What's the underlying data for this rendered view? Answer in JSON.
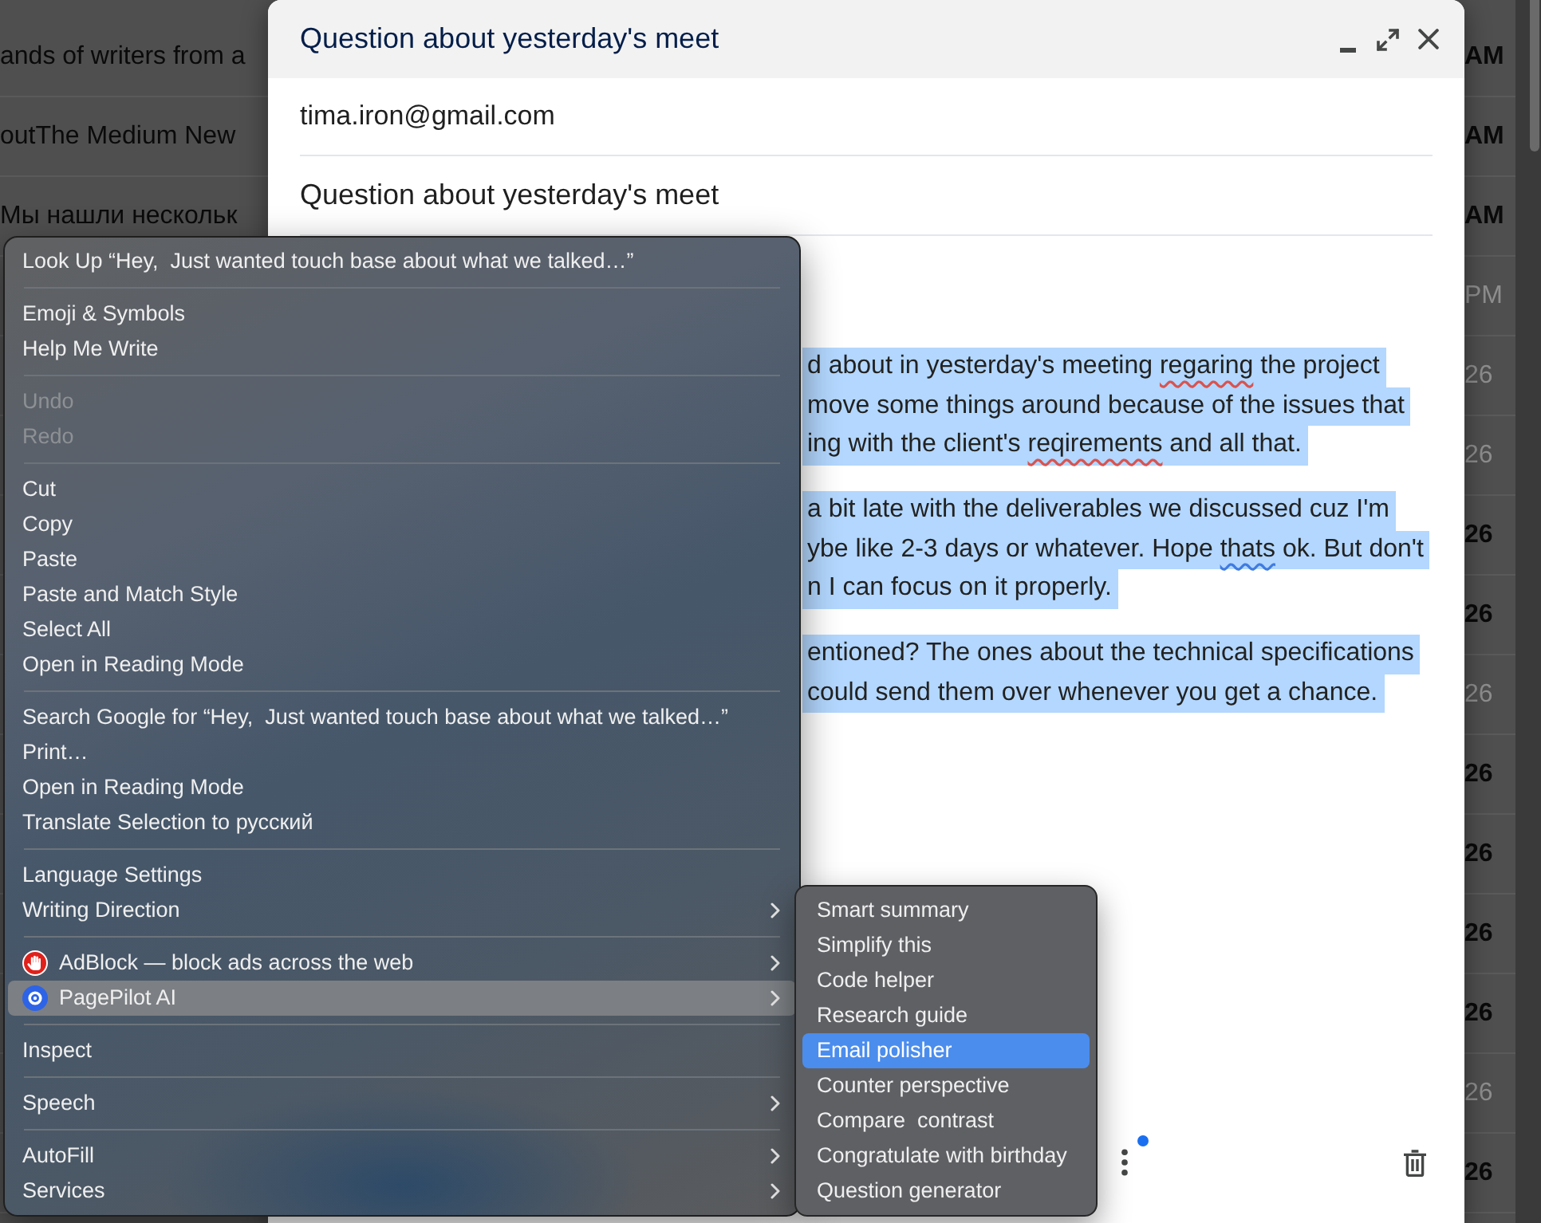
{
  "inbox": {
    "rows": [
      {
        "snippet": "ands of writers from a",
        "time": "AM",
        "unread": true
      },
      {
        "snippet": "outThe Medium New",
        "time": "AM",
        "unread": true
      },
      {
        "snippet": "Мы нашли нескольк",
        "time": "AM",
        "unread": true
      },
      {
        "time": "PM",
        "unread": false
      },
      {
        "time": "26",
        "unread": false
      },
      {
        "time": "26",
        "unread": false
      },
      {
        "time": "26",
        "unread": true
      },
      {
        "time": "26",
        "unread": true
      },
      {
        "time": "26",
        "unread": false
      },
      {
        "time": "26",
        "unread": true
      },
      {
        "time": "26",
        "unread": true
      },
      {
        "time": "26",
        "unread": true
      },
      {
        "time": "26",
        "unread": true
      },
      {
        "time": "26",
        "unread": false
      },
      {
        "time": "26",
        "unread": true
      }
    ]
  },
  "compose": {
    "title": "Question about yesterday's meet",
    "recipient": "tima.iron@gmail.com",
    "subject": "Question about yesterday's meet",
    "body": {
      "selected": true,
      "paragraphs": [
        {
          "lines": [
            {
              "parts": [
                {
                  "text": "d about in yesterday's meeting ",
                  "kind": "plain"
                },
                {
                  "text": "regaring",
                  "kind": "spelling"
                },
                {
                  "text": " the project",
                  "kind": "plain"
                }
              ]
            },
            {
              "parts": [
                {
                  "text": "move some things around because of the issues that",
                  "kind": "plain"
                }
              ]
            },
            {
              "parts": [
                {
                  "text": "ing with the client's ",
                  "kind": "plain"
                },
                {
                  "text": "reqirements",
                  "kind": "spelling"
                },
                {
                  "text": " and all that.",
                  "kind": "plain"
                }
              ]
            }
          ]
        },
        {
          "lines": [
            {
              "parts": [
                {
                  "text": "a bit late with the deliverables we discussed cuz I'm",
                  "kind": "plain"
                }
              ]
            },
            {
              "parts": [
                {
                  "text": "ybe like 2-3 days or whatever. Hope ",
                  "kind": "plain"
                },
                {
                  "text": "thats",
                  "kind": "grammar"
                },
                {
                  "text": " ok. But don't",
                  "kind": "plain"
                }
              ]
            },
            {
              "parts": [
                {
                  "text": "n I can focus on it properly.",
                  "kind": "plain"
                }
              ]
            }
          ]
        },
        {
          "lines": [
            {
              "parts": [
                {
                  "text": "entioned? The ones about the technical specifications",
                  "kind": "plain"
                }
              ]
            },
            {
              "parts": [
                {
                  "text": "could send them over whenever you get a chance.",
                  "kind": "plain"
                }
              ]
            }
          ]
        }
      ]
    }
  },
  "context_menu": {
    "groups": [
      {
        "items": [
          {
            "label": "Look Up “Hey,  Just wanted touch base about what we talked…”",
            "kind": "command",
            "disabled": false,
            "submenu": false,
            "selected": false
          }
        ]
      },
      {
        "items": [
          {
            "label": "Emoji & Symbols",
            "kind": "command",
            "disabled": false,
            "submenu": false,
            "selected": false
          },
          {
            "label": "Help Me Write",
            "kind": "command",
            "disabled": false,
            "submenu": false,
            "selected": false
          }
        ]
      },
      {
        "items": [
          {
            "label": "Undo",
            "kind": "command",
            "disabled": true,
            "submenu": false,
            "selected": false
          },
          {
            "label": "Redo",
            "kind": "command",
            "disabled": true,
            "submenu": false,
            "selected": false
          }
        ]
      },
      {
        "items": [
          {
            "label": "Cut",
            "kind": "command",
            "disabled": false,
            "submenu": false,
            "selected": false
          },
          {
            "label": "Copy",
            "kind": "command",
            "disabled": false,
            "submenu": false,
            "selected": false
          },
          {
            "label": "Paste",
            "kind": "command",
            "disabled": false,
            "submenu": false,
            "selected": false
          },
          {
            "label": "Paste and Match Style",
            "kind": "command",
            "disabled": false,
            "submenu": false,
            "selected": false
          },
          {
            "label": "Select All",
            "kind": "command",
            "disabled": false,
            "submenu": false,
            "selected": false
          },
          {
            "label": "Open in Reading Mode",
            "kind": "command",
            "disabled": false,
            "submenu": false,
            "selected": false
          }
        ]
      },
      {
        "items": [
          {
            "label": "Search Google for “Hey,  Just wanted touch base about what we talked…”",
            "kind": "command",
            "disabled": false,
            "submenu": false,
            "selected": false
          },
          {
            "label": "Print…",
            "kind": "command",
            "disabled": false,
            "submenu": false,
            "selected": false
          },
          {
            "label": "Open in Reading Mode",
            "kind": "command",
            "disabled": false,
            "submenu": false,
            "selected": false
          },
          {
            "label": "Translate Selection to русский",
            "kind": "command",
            "disabled": false,
            "submenu": false,
            "selected": false
          }
        ]
      },
      {
        "items": [
          {
            "label": "Language Settings",
            "kind": "command",
            "disabled": false,
            "submenu": false,
            "selected": false
          },
          {
            "label": "Writing Direction",
            "kind": "command",
            "disabled": false,
            "submenu": true,
            "selected": false
          }
        ]
      },
      {
        "items": [
          {
            "label": "AdBlock — block ads across the web",
            "kind": "blocker",
            "disabled": false,
            "submenu": true,
            "selected": false
          },
          {
            "label": "PagePilot AI",
            "kind": "assistant",
            "disabled": false,
            "submenu": true,
            "selected": true
          }
        ]
      },
      {
        "items": [
          {
            "label": "Inspect",
            "kind": "command",
            "disabled": false,
            "submenu": false,
            "selected": false
          }
        ]
      },
      {
        "items": [
          {
            "label": "Speech",
            "kind": "command",
            "disabled": false,
            "submenu": true,
            "selected": false
          }
        ]
      },
      {
        "items": [
          {
            "label": "AutoFill",
            "kind": "command",
            "disabled": false,
            "submenu": true,
            "selected": false
          },
          {
            "label": "Services",
            "kind": "command",
            "disabled": false,
            "submenu": true,
            "selected": false
          }
        ]
      }
    ]
  },
  "submenu": {
    "items": [
      {
        "label": "Smart summary",
        "selected": false
      },
      {
        "label": "Simplify this",
        "selected": false
      },
      {
        "label": "Code helper",
        "selected": false
      },
      {
        "label": "Research guide",
        "selected": false
      },
      {
        "label": "Email polisher",
        "selected": true
      },
      {
        "label": "Counter perspective",
        "selected": false
      },
      {
        "label": "Compare  contrast",
        "selected": false
      },
      {
        "label": "Congratulate with birthday",
        "selected": false
      },
      {
        "label": "Question generator",
        "selected": false
      }
    ]
  }
}
